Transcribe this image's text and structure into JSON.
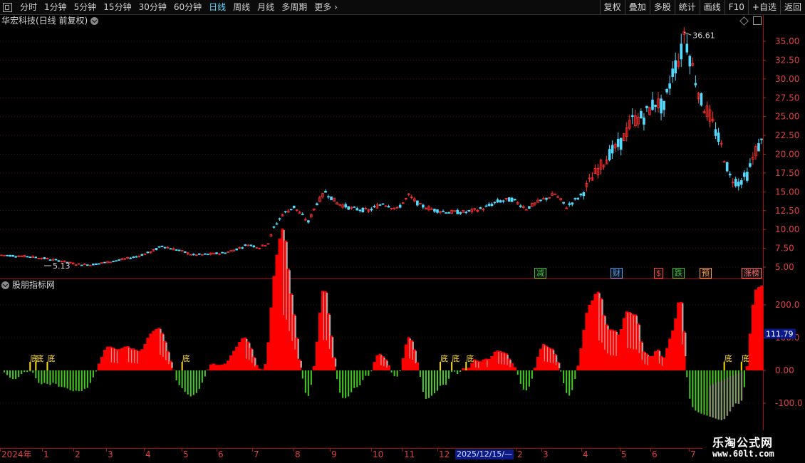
{
  "toolbar": {
    "periods": [
      "分时",
      "1分钟",
      "5分钟",
      "15分钟",
      "30分钟",
      "60分钟",
      "日线",
      "周线",
      "月线",
      "多周期",
      "更多"
    ],
    "active_period": "日线",
    "right_buttons": [
      "复权",
      "叠加",
      "多股",
      "统计",
      "画线",
      "F10",
      "+自选",
      "返回"
    ]
  },
  "main_panel": {
    "title": "华宏科技(日线 前复权)",
    "high_label": "36.61",
    "low_label": "5.13",
    "price_ticks": [
      "35.00",
      "32.50",
      "30.00",
      "27.50",
      "25.00",
      "22.50",
      "20.00",
      "17.50",
      "15.00",
      "12.50",
      "10.00",
      "7.50",
      "5.00"
    ],
    "event_tags": [
      {
        "text": "减",
        "color": "#3bc43b"
      },
      {
        "text": "财",
        "color": "#4ea0ff"
      },
      {
        "text": "$",
        "color": "#ff4040"
      },
      {
        "text": "跌",
        "color": "#3bc43b"
      },
      {
        "text": "预",
        "color": "#ff9e3b"
      },
      {
        "text": "涨榜",
        "color": "#ff6a6a"
      }
    ]
  },
  "sub_panel": {
    "title": "股朋指标网",
    "value_ticks": [
      "200.0",
      "100.0",
      "0.00",
      "-100.0"
    ],
    "current_value": "111.79",
    "signal_label": "底"
  },
  "time_axis": {
    "labels": [
      "2024年",
      "1",
      "2",
      "3",
      "4",
      "5",
      "6",
      "7",
      "8",
      "9",
      "10",
      "11",
      "12",
      "2025/12/15/—",
      "2",
      "3",
      "4",
      "5",
      "6",
      "7"
    ]
  },
  "watermark": {
    "line1": "乐淘公式网",
    "line2": "www.60lt.com"
  },
  "colors": {
    "up": "#ff3030",
    "down": "#54d9ff",
    "hist_pos": "#ff0000",
    "hist_neg": "#44cc22",
    "grey_band": "#bbbbbb",
    "magenta": "#cc33cc",
    "grid": "#8a1a1a"
  }
}
